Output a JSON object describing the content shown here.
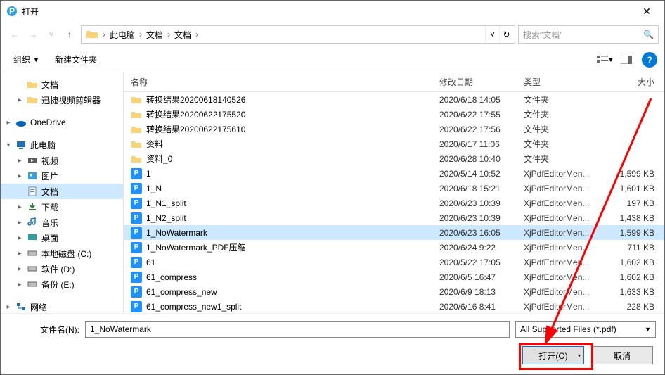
{
  "title": "打开",
  "breadcrumb": [
    "此电脑",
    "文档",
    "文档"
  ],
  "search_placeholder": "搜索\"文档\"",
  "toolbar": {
    "org": "组织",
    "newfolder": "新建文件夹"
  },
  "sidebar": [
    {
      "label": "文档",
      "icon": "folder",
      "indent": 1,
      "arrow": "none"
    },
    {
      "label": "迅捷视频剪辑器",
      "icon": "folder",
      "indent": 1,
      "arrow": "right"
    },
    {
      "label": "",
      "spacer": true
    },
    {
      "label": "OneDrive",
      "icon": "onedrive",
      "indent": 0,
      "arrow": "right"
    },
    {
      "label": "",
      "spacer": true
    },
    {
      "label": "此电脑",
      "icon": "pc",
      "indent": 0,
      "arrow": "down"
    },
    {
      "label": "视频",
      "icon": "video",
      "indent": 1,
      "arrow": "right"
    },
    {
      "label": "图片",
      "icon": "pictures",
      "indent": 1,
      "arrow": "right"
    },
    {
      "label": "文档",
      "icon": "doc",
      "indent": 1,
      "arrow": "none",
      "sel": true
    },
    {
      "label": "下载",
      "icon": "download",
      "indent": 1,
      "arrow": "right"
    },
    {
      "label": "音乐",
      "icon": "music",
      "indent": 1,
      "arrow": "right"
    },
    {
      "label": "桌面",
      "icon": "desktop",
      "indent": 1,
      "arrow": "right"
    },
    {
      "label": "本地磁盘 (C:)",
      "icon": "disk",
      "indent": 1,
      "arrow": "right"
    },
    {
      "label": "软件 (D:)",
      "icon": "disk",
      "indent": 1,
      "arrow": "right"
    },
    {
      "label": "备份 (E:)",
      "icon": "disk",
      "indent": 1,
      "arrow": "right"
    },
    {
      "label": "",
      "spacer": true
    },
    {
      "label": "网络",
      "icon": "network",
      "indent": 0,
      "arrow": "right"
    }
  ],
  "columns": {
    "name": "名称",
    "date": "修改日期",
    "type": "类型",
    "size": "大小"
  },
  "rows": [
    {
      "name": "转换结果20200618140526",
      "date": "2020/6/18 14:05",
      "type": "文件夹",
      "size": "",
      "icon": "folder"
    },
    {
      "name": "转换结果20200622175520",
      "date": "2020/6/22 17:55",
      "type": "文件夹",
      "size": "",
      "icon": "folder"
    },
    {
      "name": "转换结果20200622175610",
      "date": "2020/6/22 17:56",
      "type": "文件夹",
      "size": "",
      "icon": "folder"
    },
    {
      "name": "资料",
      "date": "2020/6/17 11:06",
      "type": "文件夹",
      "size": "",
      "icon": "folder"
    },
    {
      "name": "资料_0",
      "date": "2020/6/28 10:40",
      "type": "文件夹",
      "size": "",
      "icon": "folder"
    },
    {
      "name": "1",
      "date": "2020/5/14 10:52",
      "type": "XjPdfEditorMen...",
      "size": "1,599 KB",
      "icon": "pdf"
    },
    {
      "name": "1_N",
      "date": "2020/6/18 15:21",
      "type": "XjPdfEditorMen...",
      "size": "1,601 KB",
      "icon": "pdf"
    },
    {
      "name": "1_N1_split",
      "date": "2020/6/23 10:39",
      "type": "XjPdfEditorMen...",
      "size": "197 KB",
      "icon": "pdf"
    },
    {
      "name": "1_N2_split",
      "date": "2020/6/23 10:39",
      "type": "XjPdfEditorMen...",
      "size": "1,438 KB",
      "icon": "pdf"
    },
    {
      "name": "1_NoWatermark",
      "date": "2020/6/23 16:05",
      "type": "XjPdfEditorMen...",
      "size": "1,599 KB",
      "icon": "pdf",
      "sel": true
    },
    {
      "name": "1_NoWatermark_PDF压缩",
      "date": "2020/6/24 9:22",
      "type": "XjPdfEditorMen...",
      "size": "711 KB",
      "icon": "pdf"
    },
    {
      "name": "61",
      "date": "2020/5/22 17:05",
      "type": "XjPdfEditorMen...",
      "size": "1,602 KB",
      "icon": "pdf"
    },
    {
      "name": "61_compress",
      "date": "2020/6/5 16:47",
      "type": "XjPdfEditorMen...",
      "size": "1,602 KB",
      "icon": "pdf"
    },
    {
      "name": "61_compress_new",
      "date": "2020/6/9 18:13",
      "type": "XjPdfEditorMen...",
      "size": "1,633 KB",
      "icon": "pdf"
    },
    {
      "name": "61_compress_new1_split",
      "date": "2020/6/16 8:41",
      "type": "XjPdfEditorMen...",
      "size": "228 KB",
      "icon": "pdf"
    }
  ],
  "filename_label": "文件名(N):",
  "filename_value": "1_NoWatermark",
  "filter": "All Supported Files (*.pdf)",
  "open_btn": "打开(O)",
  "cancel_btn": "取消"
}
